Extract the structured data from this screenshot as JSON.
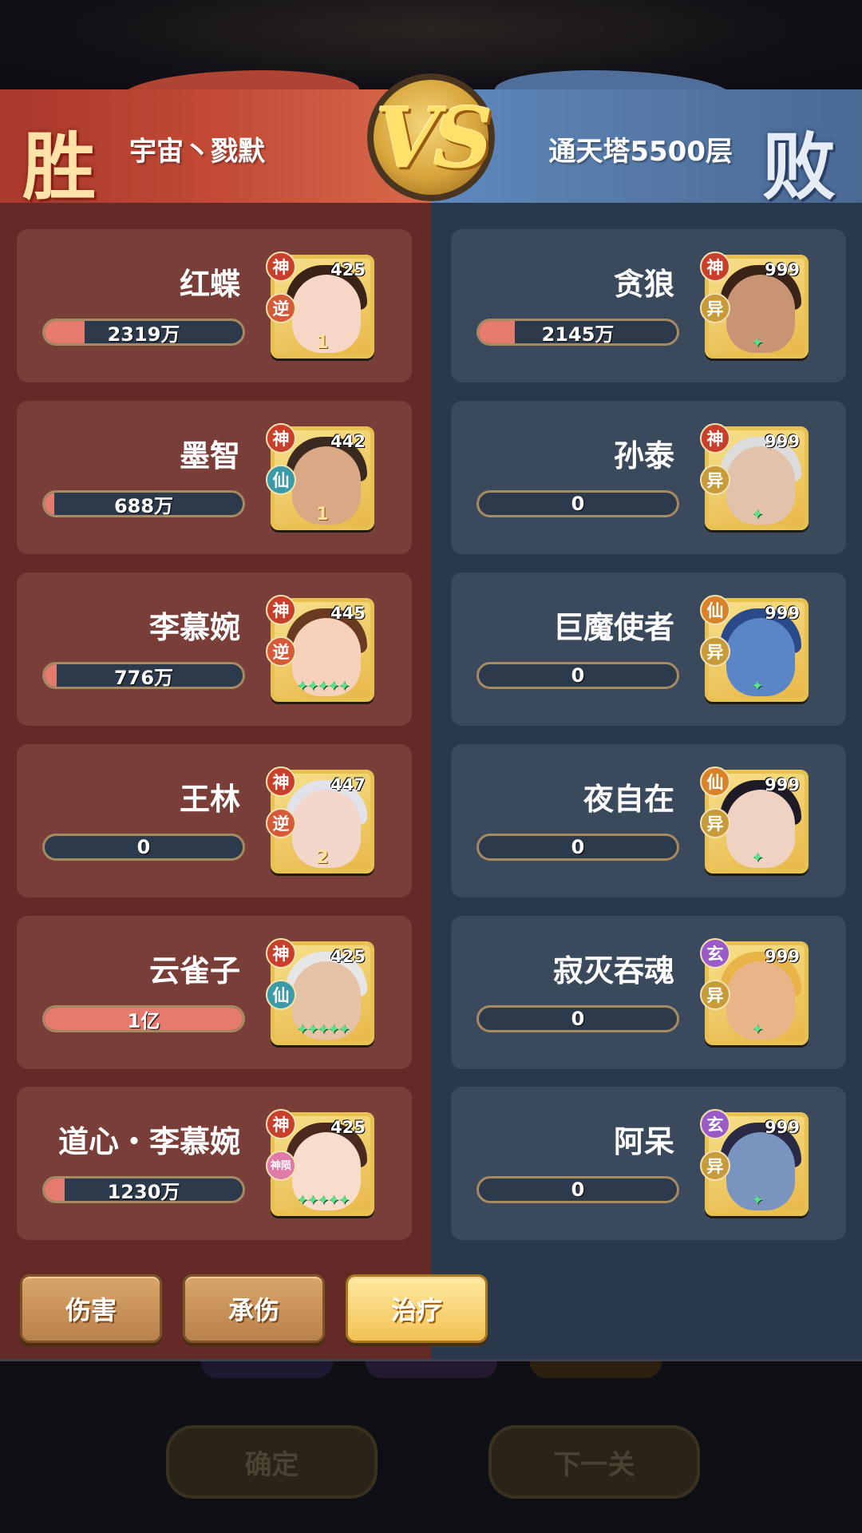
{
  "header": {
    "win_mark": "胜",
    "lose_mark": "败",
    "left_team": "宇宙丶戮默",
    "right_team": "通天塔5500层",
    "vs_label": "VS"
  },
  "left_heroes": [
    {
      "name": "红蝶",
      "value": "2319万",
      "fill": 0.2,
      "level": "425",
      "rank": "神",
      "type": "逆",
      "rank_color": "#c8402c",
      "type_color": "#d45a3a",
      "decor": "1",
      "hair": "#3a2418",
      "skin": "#f6d6c4"
    },
    {
      "name": "墨智",
      "value": "688万",
      "fill": 0.05,
      "level": "442",
      "rank": "神",
      "type": "仙",
      "rank_color": "#c8402c",
      "type_color": "#3a9aa8",
      "decor": "1",
      "hair": "#3a2a20",
      "skin": "#d9a884"
    },
    {
      "name": "李慕婉",
      "value": "776万",
      "fill": 0.06,
      "level": "445",
      "rank": "神",
      "type": "逆",
      "rank_color": "#c8402c",
      "type_color": "#d45a3a",
      "decor": "✦✦✦✦✦",
      "hair": "#6a3a22",
      "skin": "#f6d2bc"
    },
    {
      "name": "王林",
      "value": "0",
      "fill": 0,
      "level": "447",
      "rank": "神",
      "type": "逆",
      "rank_color": "#c8402c",
      "type_color": "#d45a3a",
      "decor": "2",
      "hair": "#e2e2ea",
      "skin": "#f2d6ca"
    },
    {
      "name": "云雀子",
      "value": "1亿",
      "fill": 1.0,
      "level": "425",
      "rank": "神",
      "type": "仙",
      "rank_color": "#c8402c",
      "type_color": "#3a9aa8",
      "decor": "✦✦✦✦✦",
      "hair": "#e6e6e6",
      "skin": "#e6c2a6"
    },
    {
      "name": "道心・李慕婉",
      "value": "1230万",
      "fill": 0.1,
      "level": "425",
      "rank": "神",
      "type": "神陨",
      "rank_color": "#c8402c",
      "type_color": "#e07aa8",
      "decor": "✦✦✦✦✦",
      "hair": "#4a2a1e",
      "skin": "#f8dccc"
    }
  ],
  "right_heroes": [
    {
      "name": "贪狼",
      "value": "2145万",
      "fill": 0.18,
      "level": "999",
      "rank": "神",
      "type": "异",
      "rank_color": "#c8402c",
      "type_color": "#c79a3a",
      "decor": "✦",
      "hair": "#3a2418",
      "skin": "#c99474"
    },
    {
      "name": "孙泰",
      "value": "0",
      "fill": 0,
      "level": "999",
      "rank": "神",
      "type": "异",
      "rank_color": "#c8402c",
      "type_color": "#c79a3a",
      "decor": "✦",
      "hair": "#dcdcdc",
      "skin": "#e2c2aa"
    },
    {
      "name": "巨魔使者",
      "value": "0",
      "fill": 0,
      "level": "999",
      "rank": "仙",
      "type": "异",
      "rank_color": "#d9822a",
      "type_color": "#c79a3a",
      "decor": "✦",
      "hair": "#2a4a8a",
      "skin": "#5a86c8"
    },
    {
      "name": "夜自在",
      "value": "0",
      "fill": 0,
      "level": "999",
      "rank": "仙",
      "type": "异",
      "rank_color": "#d9822a",
      "type_color": "#c79a3a",
      "decor": "✦",
      "hair": "#1e1a26",
      "skin": "#f0d2c2"
    },
    {
      "name": "寂灭吞魂",
      "value": "0",
      "fill": 0,
      "level": "999",
      "rank": "玄",
      "type": "异",
      "rank_color": "#9a5ac8",
      "type_color": "#c79a3a",
      "decor": "✦",
      "hair": "#e8b448",
      "skin": "#e8b488"
    },
    {
      "name": "阿呆",
      "value": "0",
      "fill": 0,
      "level": "999",
      "rank": "玄",
      "type": "异",
      "rank_color": "#9a5ac8",
      "type_color": "#c79a3a",
      "decor": "✦",
      "hair": "#2a2a44",
      "skin": "#7a94c0"
    }
  ],
  "tabs": [
    {
      "label": "伤害",
      "active": false
    },
    {
      "label": "承伤",
      "active": false
    },
    {
      "label": "治疗",
      "active": true
    }
  ],
  "footer": {
    "confirm_label": "确定",
    "next_label": "下一关"
  },
  "colors": {
    "win_panel": "#632a27",
    "lose_panel": "#29384a",
    "bar_fill": "#e57a6e"
  }
}
